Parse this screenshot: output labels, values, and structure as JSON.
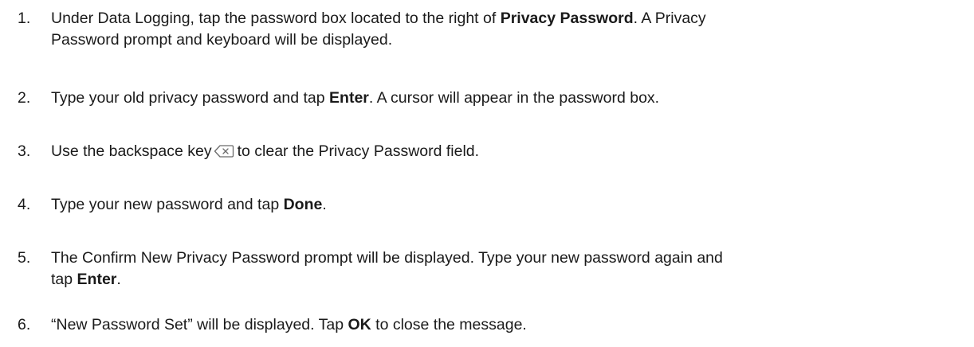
{
  "steps": [
    {
      "number": "1.",
      "line1_a": "Under Data Logging, tap the password box located to the right of ",
      "line1_b": "Privacy Password",
      "line1_c": ". A Privacy",
      "line2": "Password prompt and keyboard will be displayed."
    },
    {
      "number": "2.",
      "text_a": "Type your old privacy password and tap ",
      "text_b": "Enter",
      "text_c": ". A cursor will appear in the password box."
    },
    {
      "number": "3.",
      "text_a": "Use the backspace key",
      "icon": "backspace-key-icon",
      "text_b": "to clear the Privacy Password field."
    },
    {
      "number": "4.",
      "text_a": "Type your new password and tap ",
      "text_b": "Done",
      "text_c": "."
    },
    {
      "number": "5.",
      "line1": "The Confirm New Privacy Password prompt will be displayed. Type your new password again and",
      "line2_a": "tap ",
      "line2_b": "Enter",
      "line2_c": "."
    },
    {
      "number": "6.",
      "text_a": "“New Password Set” will be displayed. Tap ",
      "text_b": "OK",
      "text_c": " to close the message."
    }
  ]
}
